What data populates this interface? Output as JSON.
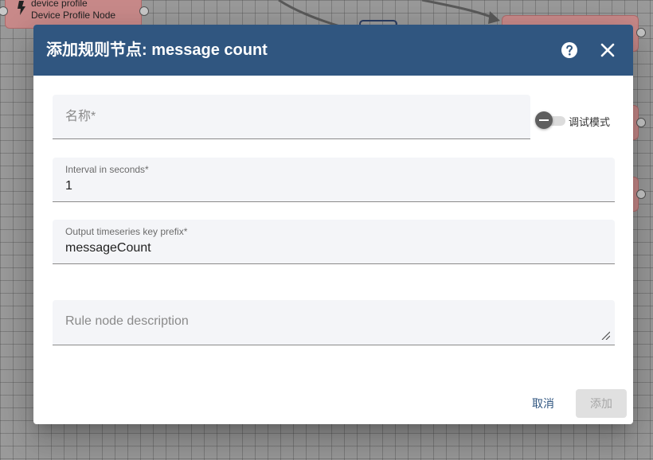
{
  "background_node": {
    "type": "device profile",
    "name": "Device Profile Node"
  },
  "dialog": {
    "title": "添加规则节点: message count",
    "fields": {
      "name": {
        "placeholder": "名称*",
        "value": ""
      },
      "interval": {
        "label": "Interval in seconds*",
        "value": "1"
      },
      "prefix": {
        "label": "Output timeseries key prefix*",
        "value": "messageCount"
      },
      "description": {
        "placeholder": "Rule node description",
        "value": ""
      }
    },
    "debug_toggle": {
      "label": "调试模式",
      "enabled": false
    },
    "buttons": {
      "cancel": "取消",
      "add": "添加"
    }
  },
  "icons": [
    "lightning-bolt-icon",
    "help-icon",
    "close-icon",
    "resize-grip-icon"
  ],
  "colors": {
    "header": "#305680",
    "node": "#c98a8a",
    "primary_text": "#305680"
  }
}
